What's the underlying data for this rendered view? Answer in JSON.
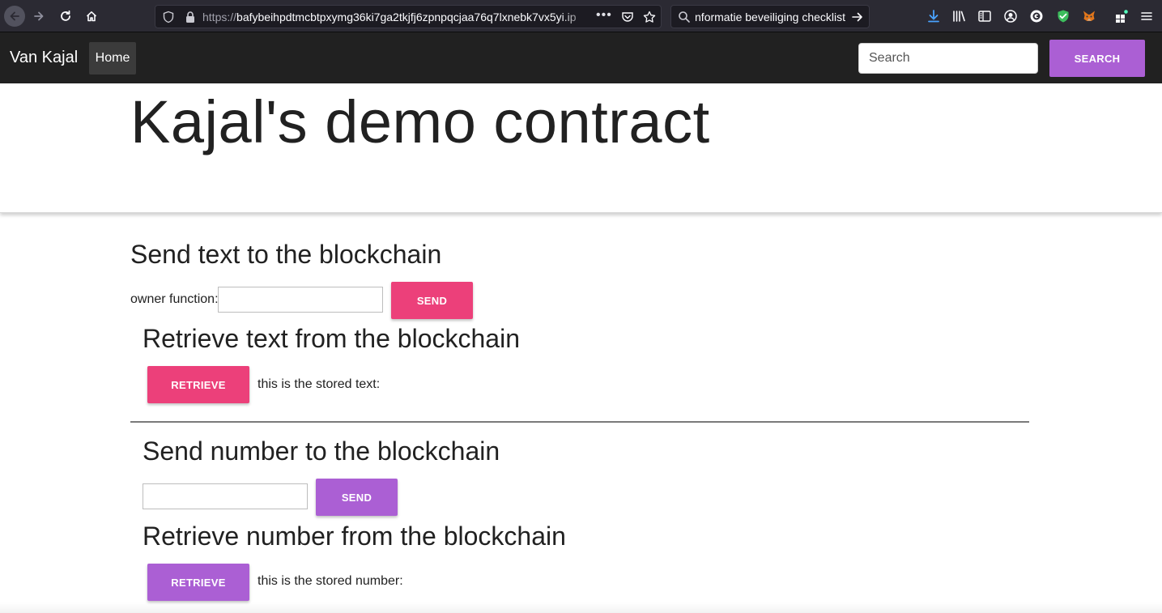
{
  "browser": {
    "url_scheme": "https://",
    "url_host": "bafybeihpdtmcbtpxymg36ki7ga2tkjfj6zpnpqcjaa76q7lxnebk7vx5yi.ip",
    "search_text": "informatie beveiliging checklist",
    "more_label": "•••"
  },
  "navbar": {
    "brand": "Van Kajal",
    "home_label": "Home",
    "search_placeholder": "Search",
    "search_button": "SEARCH"
  },
  "page": {
    "title": "Kajal's demo contract"
  },
  "text_section": {
    "send_heading": "Send text to the blockchain",
    "owner_label": "owner function:",
    "owner_value": "",
    "send_button": "SEND",
    "retrieve_heading": "Retrieve text from the blockchain",
    "retrieve_button": "RETRIEVE",
    "stored_label": "this is the stored text:"
  },
  "number_section": {
    "send_heading": "Send number to the blockchain",
    "number_value": "",
    "send_button": "SEND",
    "retrieve_heading": "Retrieve number from the blockchain",
    "retrieve_button": "RETRIEVE",
    "stored_label": "this is the stored number:"
  },
  "colors": {
    "navbar_bg": "#212121",
    "accent_purple": "#ab5fd4",
    "accent_pink": "#ec407a"
  },
  "icons": [
    "back-arrow-icon",
    "forward-arrow-icon",
    "reload-icon",
    "home-icon",
    "shield-icon",
    "lock-icon",
    "pocket-icon",
    "bookmark-star-icon",
    "search-icon",
    "go-arrow-icon",
    "download-icon",
    "library-icon",
    "sidebar-icon",
    "account-icon",
    "extension-icon",
    "shield-extension-icon",
    "metamask-icon",
    "extensions-puzzle-icon",
    "menu-icon"
  ]
}
